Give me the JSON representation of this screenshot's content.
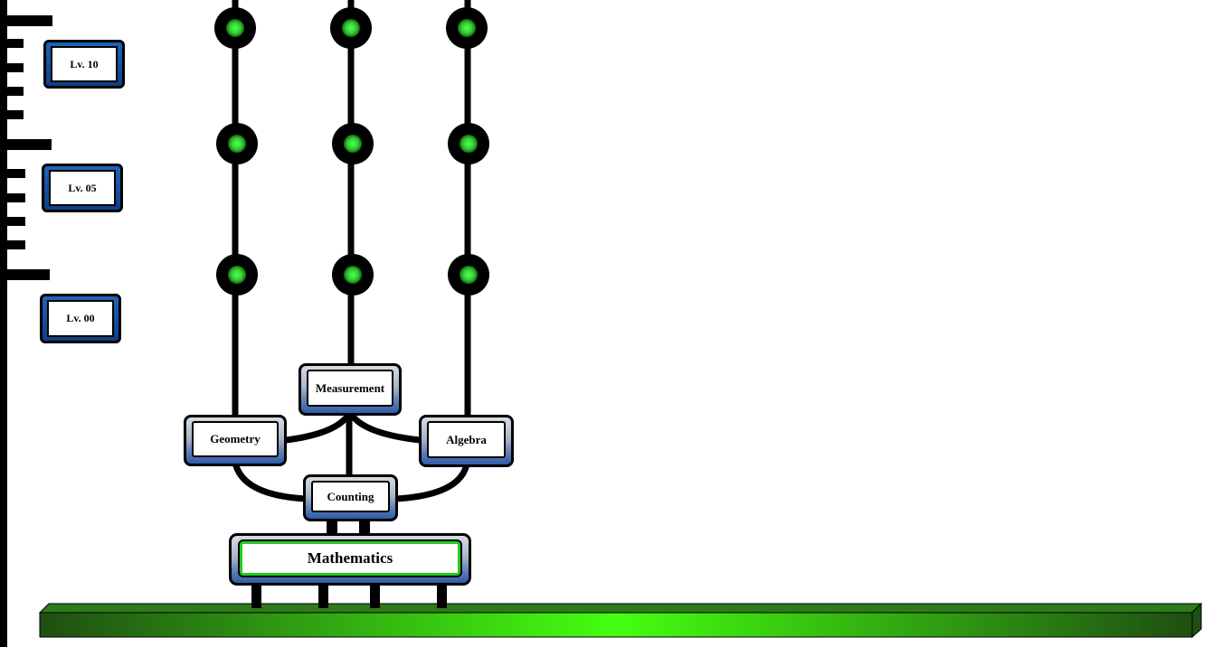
{
  "root_skill": {
    "label": "Mathematics"
  },
  "skills": {
    "counting": "Counting",
    "geometry": "Geometry",
    "measurement": "Measurement",
    "algebra": "Algebra"
  },
  "levels": [
    {
      "label": "Lv. 10"
    },
    {
      "label": "Lv. 05"
    },
    {
      "label": "Lv. 00"
    }
  ],
  "colors": {
    "node_green": "#33cc33",
    "platform_green": "#44ff11",
    "box_blue": "#2f5ba8",
    "level_blue": "#1f64b8"
  }
}
